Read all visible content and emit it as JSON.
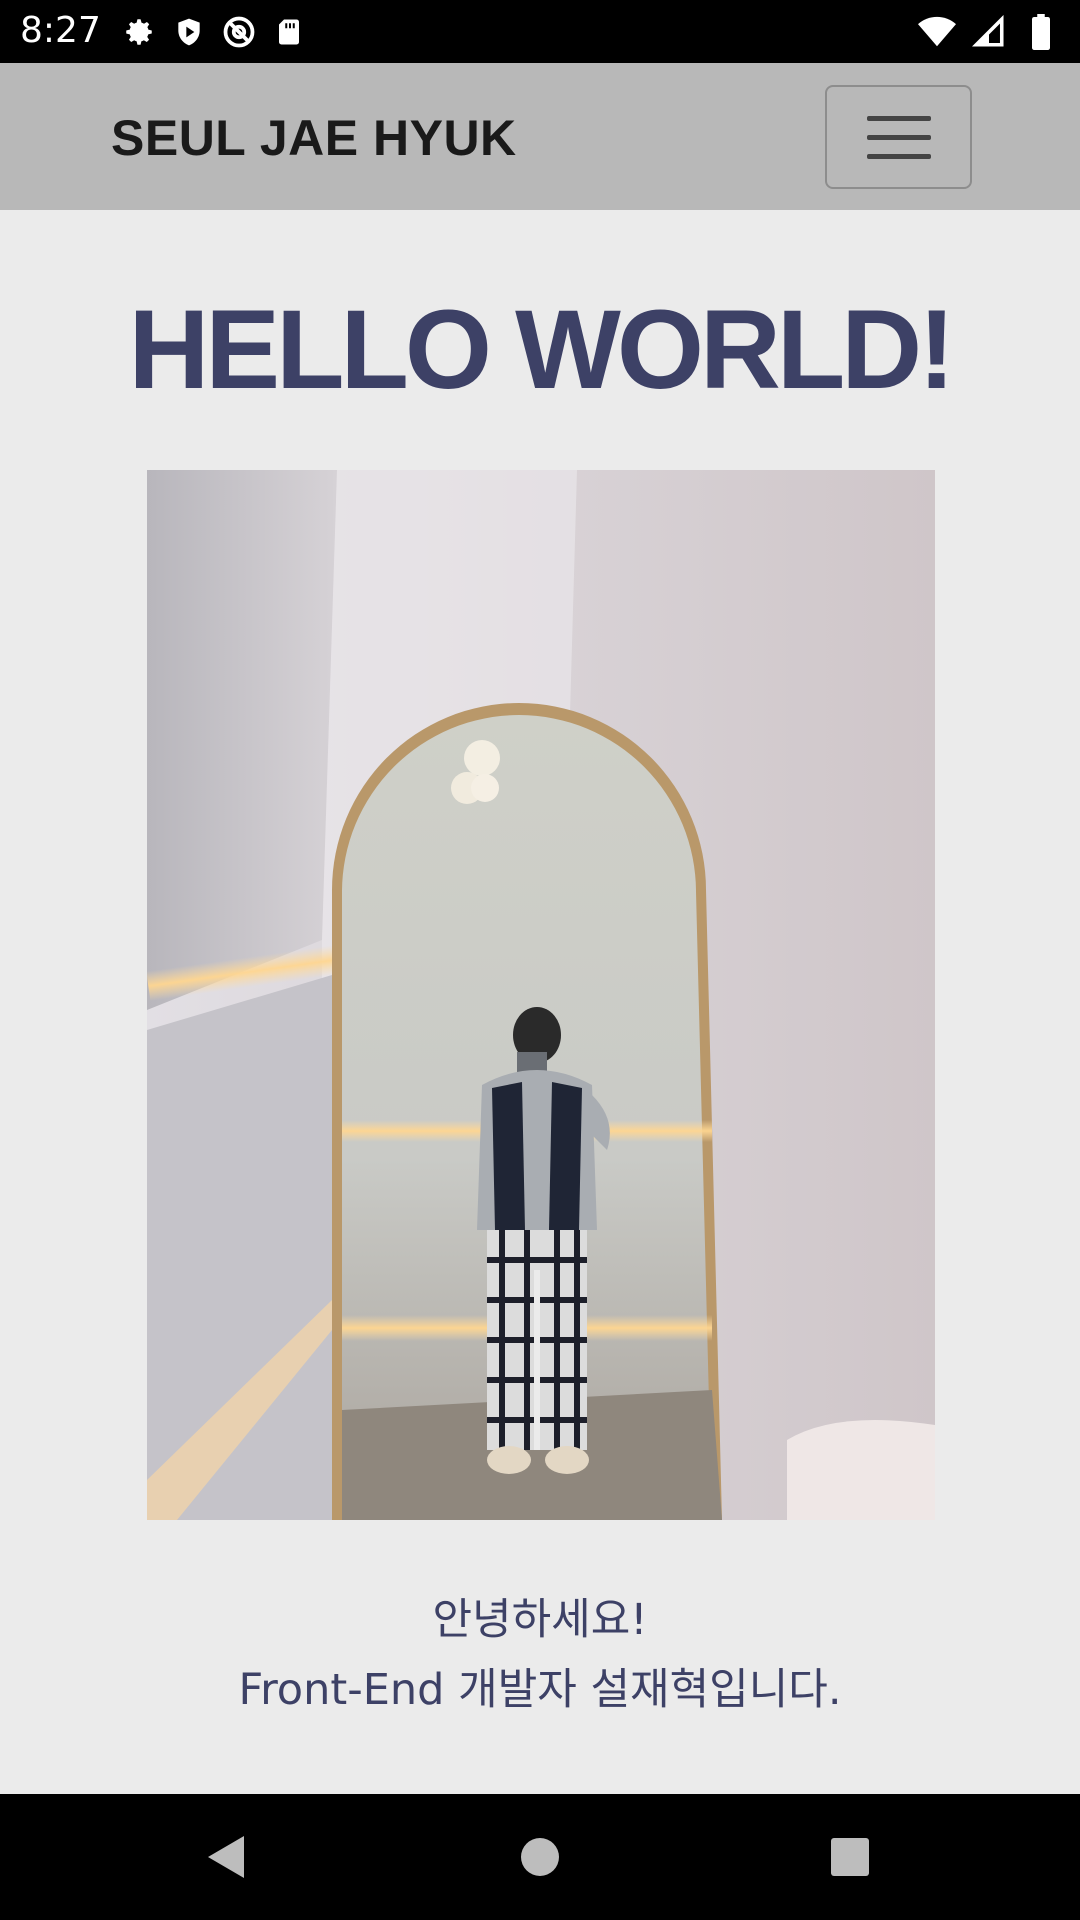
{
  "status_bar": {
    "time": "8:27",
    "left_icons": [
      "settings-icon",
      "shield-play-icon",
      "no-sync-icon",
      "sd-card-icon"
    ],
    "right_icons": [
      "wifi-icon",
      "signal-icon",
      "battery-icon"
    ]
  },
  "navbar": {
    "brand": "SEUL JAE HYUK",
    "menu_icon": "hamburger-menu-icon"
  },
  "main": {
    "title": "HELLO WORLD!",
    "intro_line1": "안녕하세요!",
    "intro_line2": "Front-End 개발자 설재혁입니다."
  },
  "colors": {
    "accent": "#3d4166",
    "navbar_bg": "#b8b8b8",
    "page_bg": "#ebebeb"
  },
  "system_nav": {
    "back_icon": "back-triangle-icon",
    "home_icon": "home-circle-icon",
    "recents_icon": "recents-square-icon"
  }
}
